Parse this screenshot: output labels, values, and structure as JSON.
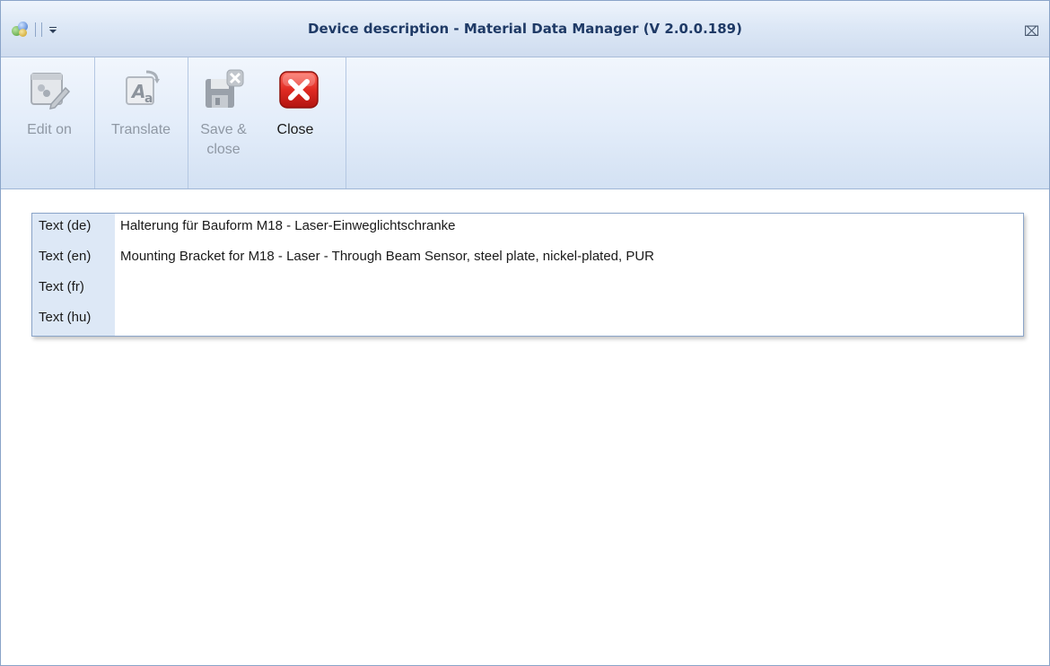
{
  "window": {
    "title": "Device description - Material Data Manager (V 2.0.0.189)",
    "close_glyph": "⌧"
  },
  "toolbar": {
    "edit_on": {
      "label": "Edit on",
      "icon": "edit-document-icon",
      "enabled": false
    },
    "translate": {
      "label": "Translate",
      "icon": "translate-icon",
      "enabled": false
    },
    "save_close": {
      "label": "Save & close",
      "icon": "save-close-icon",
      "enabled": false
    },
    "close": {
      "label": "Close",
      "icon": "close-red-x-icon",
      "enabled": true
    }
  },
  "texts": [
    {
      "label": "Text (de)",
      "value": "Halterung für Bauform M18 - Laser-Einweglichtschranke"
    },
    {
      "label": "Text (en)",
      "value": "Mounting Bracket for M18 - Laser - Through Beam Sensor, steel plate, nickel-plated, PUR"
    },
    {
      "label": "Text (fr)",
      "value": ""
    },
    {
      "label": "Text (hu)",
      "value": ""
    }
  ],
  "colors": {
    "accent_title": "#1f3a66",
    "close_button_red": "#d42a2a",
    "disabled_text": "#8f98a4"
  }
}
